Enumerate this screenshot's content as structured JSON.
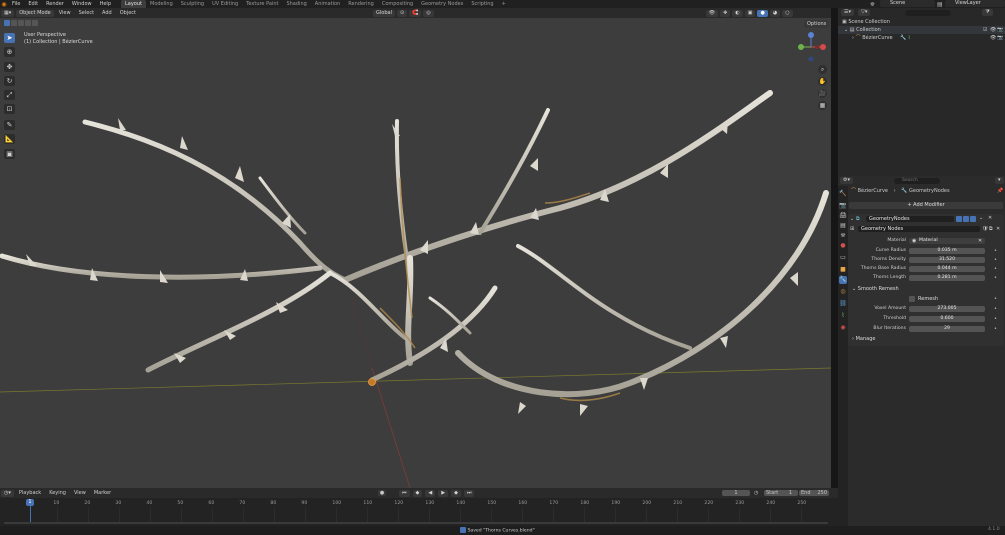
{
  "menu": [
    "File",
    "Edit",
    "Render",
    "Window",
    "Help"
  ],
  "workspaces": [
    "Layout",
    "Modeling",
    "Sculpting",
    "UV Editing",
    "Texture Paint",
    "Shading",
    "Animation",
    "Rendering",
    "Compositing",
    "Geometry Nodes",
    "Scripting"
  ],
  "add_tab": "+",
  "scene": "Scene",
  "view_layer": "ViewLayer",
  "viewport": {
    "mode": "Object Mode",
    "menus": [
      "View",
      "Select",
      "Add",
      "Object"
    ],
    "transform": "Global",
    "options": "Options",
    "info_line1": "User Perspective",
    "info_line2": "(1) Collection | BézierCurve",
    "gizmo_x": "X",
    "gizmo_y": "Y",
    "gizmo_z": "Z"
  },
  "outliner": {
    "search_placeholder": "",
    "scene_collection": "Scene Collection",
    "collection": "Collection",
    "object": "BézierCurve"
  },
  "properties": {
    "search_placeholder": "Search",
    "breadcrumb_object": "BézierCurve",
    "breadcrumb_modifier": "GeometryNodes",
    "add_modifier": "Add Modifier",
    "modifier_name": "GeometryNodes",
    "node_group": "Geometry Nodes",
    "fields": [
      {
        "label": "Material",
        "value": "Material"
      },
      {
        "label": "Curve Radius",
        "value": "0.035 m"
      },
      {
        "label": "Thorns Density",
        "value": "31.520"
      },
      {
        "label": "Thorns Base Radius",
        "value": "0.044 m"
      },
      {
        "label": "Thorns Length",
        "value": "0.281 m"
      }
    ],
    "smooth_panel": "Smooth Remesh",
    "remesh_label": "Remesh",
    "smooth_fields": [
      {
        "label": "Voxel Amount",
        "value": "273.005"
      },
      {
        "label": "Threshold",
        "value": "0.600"
      },
      {
        "label": "Blur Iterations",
        "value": "29"
      }
    ],
    "manage": "Manage"
  },
  "timeline": {
    "menus": [
      "Playback",
      "Keying",
      "View",
      "Marker"
    ],
    "current_frame": "1",
    "start_label": "Start",
    "start": "1",
    "end_label": "End",
    "end": "250",
    "ticks": [
      "10",
      "20",
      "30",
      "40",
      "50",
      "60",
      "70",
      "80",
      "90",
      "100",
      "110",
      "120",
      "130",
      "140",
      "150",
      "160",
      "170",
      "180",
      "190",
      "200",
      "210",
      "220",
      "230",
      "240",
      "250"
    ],
    "playhead": "1"
  },
  "status": {
    "message": "Saved \"Thorns Curves.blend\"",
    "version": "4.1.0"
  },
  "colors": {
    "accent": "#4772b3",
    "viewport_bg": "#3d3d3d",
    "curve_fill": "#c9c3b4",
    "curve_inner": "#b08a4a"
  }
}
